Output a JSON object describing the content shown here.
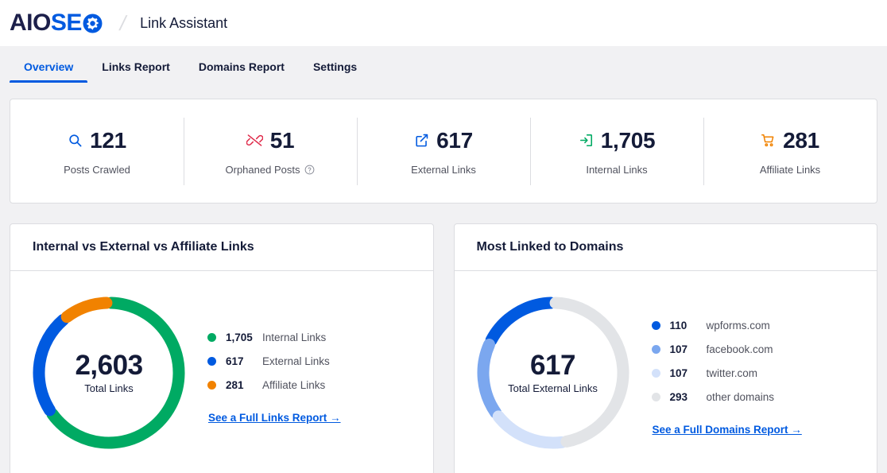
{
  "header": {
    "logo_part1": "AIO",
    "logo_part2": "SE",
    "logo_gear_icon": "gear-icon",
    "separator": "/",
    "title": "Link Assistant"
  },
  "tabs": [
    {
      "label": "Overview",
      "active": true
    },
    {
      "label": "Links Report",
      "active": false
    },
    {
      "label": "Domains Report",
      "active": false
    },
    {
      "label": "Settings",
      "active": false
    }
  ],
  "stats": [
    {
      "value": "121",
      "label": "Posts Crawled",
      "icon": "search-icon",
      "color": "#005ae0",
      "help": false
    },
    {
      "value": "51",
      "label": "Orphaned Posts",
      "icon": "broken-link-icon",
      "color": "#df2a4a",
      "help": true
    },
    {
      "value": "617",
      "label": "External Links",
      "icon": "external-link-icon",
      "color": "#005ae0",
      "help": false
    },
    {
      "value": "1,705",
      "label": "Internal Links",
      "icon": "internal-link-icon",
      "color": "#00aa63",
      "help": false
    },
    {
      "value": "281",
      "label": "Affiliate Links",
      "icon": "cart-icon",
      "color": "#f18200",
      "help": false
    }
  ],
  "panels": [
    {
      "title": "Internal vs External vs Affiliate Links",
      "total": "2,603",
      "total_label": "Total Links",
      "link_label": "See a Full Links Report →",
      "legend": [
        {
          "value": "1,705",
          "name": "Internal Links",
          "color": "#00aa63"
        },
        {
          "value": "617",
          "name": "External Links",
          "color": "#005ae0"
        },
        {
          "value": "281",
          "name": "Affiliate Links",
          "color": "#f18200"
        }
      ]
    },
    {
      "title": "Most Linked to Domains",
      "total": "617",
      "total_label": "Total External Links",
      "link_label": "See a Full Domains Report →",
      "legend": [
        {
          "value": "110",
          "name": "wpforms.com",
          "color": "#005ae0"
        },
        {
          "value": "107",
          "name": "facebook.com",
          "color": "#7ba7ef"
        },
        {
          "value": "107",
          "name": "twitter.com",
          "color": "#d3e1fa"
        },
        {
          "value": "293",
          "name": "other domains",
          "color": "#e2e4e7"
        }
      ]
    }
  ],
  "chart_data": [
    {
      "type": "pie",
      "title": "Internal vs External vs Affiliate Links",
      "center_value": 2603,
      "center_label": "Total Links",
      "categories": [
        "Internal Links",
        "External Links",
        "Affiliate Links"
      ],
      "values": [
        1705,
        617,
        281
      ],
      "colors": [
        "#00aa63",
        "#005ae0",
        "#f18200"
      ],
      "legend_position": "right",
      "donut": true
    },
    {
      "type": "pie",
      "title": "Most Linked to Domains",
      "center_value": 617,
      "center_label": "Total External Links",
      "categories": [
        "wpforms.com",
        "facebook.com",
        "twitter.com",
        "other domains"
      ],
      "values": [
        110,
        107,
        107,
        293
      ],
      "colors": [
        "#005ae0",
        "#7ba7ef",
        "#d3e1fa",
        "#e2e4e7"
      ],
      "legend_position": "right",
      "donut": true
    }
  ]
}
